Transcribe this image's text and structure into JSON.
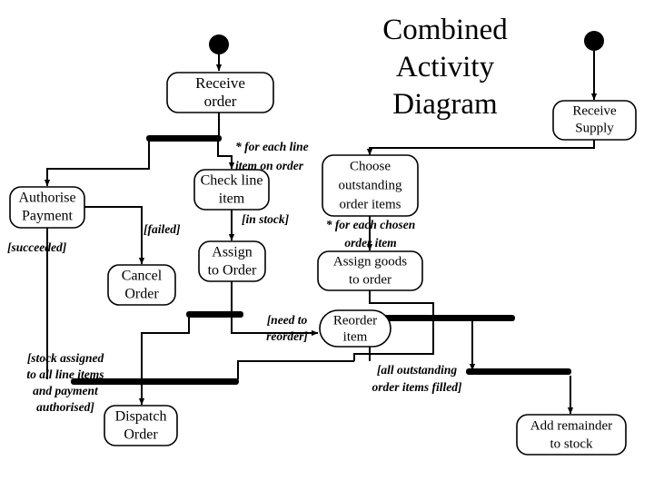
{
  "title": {
    "lines": [
      "Combined",
      "Activity",
      "Diagram"
    ]
  },
  "nodes": [
    {
      "id": "receive-order",
      "label_lines": [
        "Receive",
        "order"
      ],
      "shape": "rounded-rect"
    },
    {
      "id": "authorise-payment",
      "label_lines": [
        "Authorise",
        "Payment"
      ],
      "shape": "rounded-rect"
    },
    {
      "id": "check-line-item",
      "label_lines": [
        "Check line",
        "item"
      ],
      "shape": "rounded-rect"
    },
    {
      "id": "cancel-order",
      "label_lines": [
        "Cancel",
        "Order"
      ],
      "shape": "rounded-rect"
    },
    {
      "id": "assign-to-order",
      "label_lines": [
        "Assign",
        "to Order"
      ],
      "shape": "rounded-rect"
    },
    {
      "id": "dispatch-order",
      "label_lines": [
        "Dispatch",
        "Order"
      ],
      "shape": "rounded-rect"
    },
    {
      "id": "receive-supply",
      "label_lines": [
        "Receive",
        "Supply"
      ],
      "shape": "rounded-rect"
    },
    {
      "id": "choose-outstanding",
      "label_lines": [
        "Choose",
        "outstanding",
        "order items"
      ],
      "shape": "rounded-rect"
    },
    {
      "id": "assign-goods",
      "label_lines": [
        "Assign goods",
        "to order"
      ],
      "shape": "rounded-rect"
    },
    {
      "id": "reorder-item",
      "label_lines": [
        "Reorder",
        "item"
      ],
      "shape": "stadium"
    },
    {
      "id": "add-remainder",
      "label_lines": [
        "Add remainder",
        "to stock"
      ],
      "shape": "rounded-rect"
    }
  ],
  "guards": [
    {
      "id": "for-each-line-item",
      "lines": [
        "* for each line",
        "item on order"
      ]
    },
    {
      "id": "in-stock",
      "lines": [
        "[in stock]"
      ]
    },
    {
      "id": "failed",
      "lines": [
        "[failed]"
      ]
    },
    {
      "id": "succeeded",
      "lines": [
        "[succeeded]"
      ]
    },
    {
      "id": "stock-assigned",
      "lines": [
        "[stock assigned",
        "to all line items",
        "and payment",
        "authorised]"
      ]
    },
    {
      "id": "need-to-reorder",
      "lines": [
        "[need to",
        "reorder]"
      ]
    },
    {
      "id": "for-each-chosen",
      "lines": [
        "* for each chosen",
        "order item"
      ]
    },
    {
      "id": "all-outstanding-filled",
      "lines": [
        "[all outstanding",
        "order items filled]"
      ]
    }
  ],
  "control_nodes": [
    {
      "id": "initial-node-order",
      "kind": "initial"
    },
    {
      "id": "initial-node-supply",
      "kind": "initial"
    },
    {
      "id": "fork-bar-order",
      "kind": "fork"
    },
    {
      "id": "join-bar-lineitems",
      "kind": "join"
    },
    {
      "id": "join-bar-dispatch",
      "kind": "join"
    },
    {
      "id": "fork-bar-supply",
      "kind": "fork"
    },
    {
      "id": "join-bar-remainder",
      "kind": "join"
    }
  ],
  "colors": {
    "stroke": "#000000",
    "fill": "#ffffff",
    "background": "#ffffff"
  }
}
